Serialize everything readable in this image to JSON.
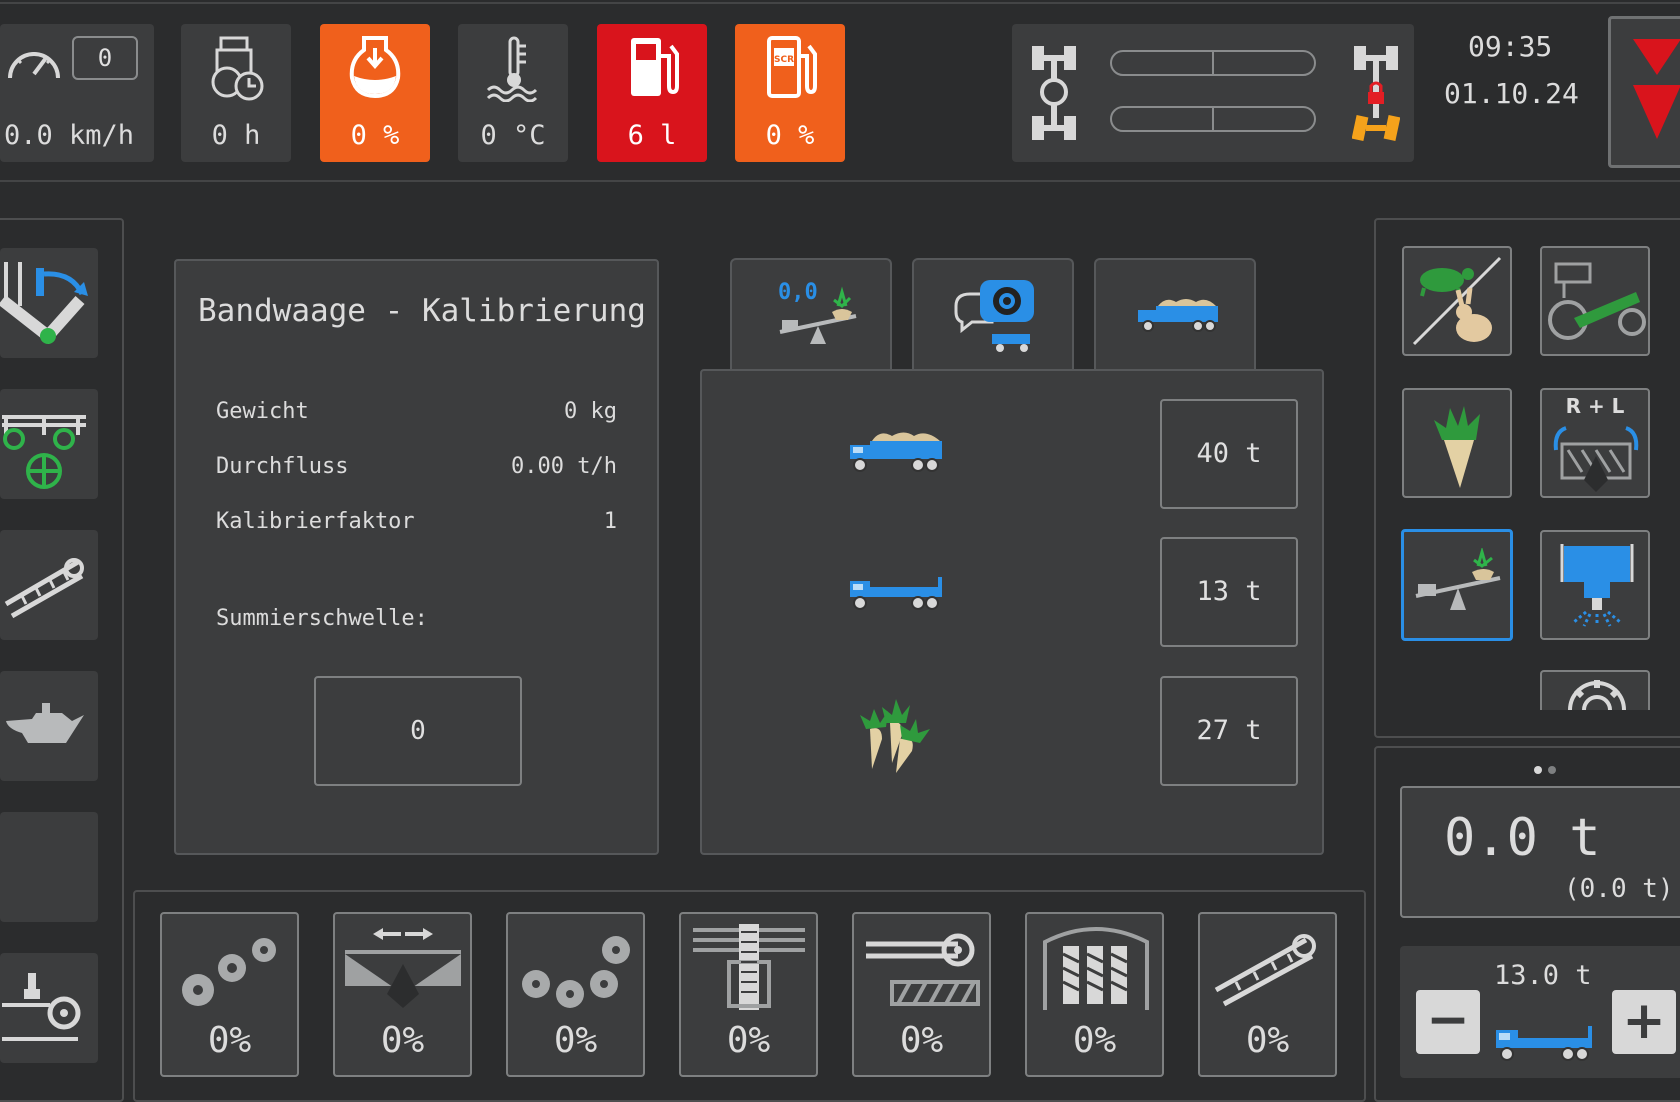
{
  "status_bar": {
    "speed_box": "0",
    "speed": "0.0 km/h",
    "hours": "0 h",
    "tank_level": "0 %",
    "coolant_temp": "0 °C",
    "fuel": "6 l",
    "adblue": "0 %",
    "adblue_icon_text": "SCR",
    "time": "09:35",
    "date": "01.10.24",
    "colors": {
      "warning_orange": "#f0601c",
      "alarm_red": "#d9141c",
      "tile_bg": "#3c3d3e",
      "accent_blue": "#2a8fe6"
    }
  },
  "left_sidebar": {
    "icons": [
      "steering-axle-icon",
      "tractor-frame-icon",
      "conveyor-icon",
      "oil-can-icon",
      "empty-slot",
      "roller-cleaner-icon"
    ]
  },
  "calibration_panel": {
    "title": "Bandwaage - Kalibrierung",
    "rows": [
      {
        "label": "Gewicht",
        "value": "0 kg"
      },
      {
        "label": "Durchfluss",
        "value": "0.00 t/h"
      },
      {
        "label": "Kalibrierfaktor",
        "value": "1"
      }
    ],
    "threshold_label": "Summierschwelle:",
    "threshold_value": "0"
  },
  "tabs": {
    "tab1_value": "0,0",
    "items": [
      "scale-tab",
      "settings-tab",
      "truck-tab"
    ]
  },
  "truck_panel": {
    "rows": [
      {
        "icon": "loaded-truck-icon",
        "value": "40 t"
      },
      {
        "icon": "empty-truck-icon",
        "value": "13 t"
      },
      {
        "icon": "beets-icon",
        "value": "27 t"
      }
    ]
  },
  "bottom_bar": {
    "items": [
      {
        "icon": "rollers-icon",
        "value": "0%"
      },
      {
        "icon": "spreading-rollers-icon",
        "value": "0%"
      },
      {
        "icon": "roller-group-icon",
        "value": "0%"
      },
      {
        "icon": "elevator-icon",
        "value": "0%"
      },
      {
        "icon": "auger-icon",
        "value": "0%"
      },
      {
        "icon": "sieve-belt-icon",
        "value": "0%"
      },
      {
        "icon": "unloading-conveyor-icon",
        "value": "0%"
      }
    ]
  },
  "right_panel": {
    "rl_label": "R + L",
    "total": "0.0 t",
    "total_sub": "(0.0 t)",
    "adjust_value": "13.0 t",
    "minus": "−",
    "plus": "+"
  }
}
